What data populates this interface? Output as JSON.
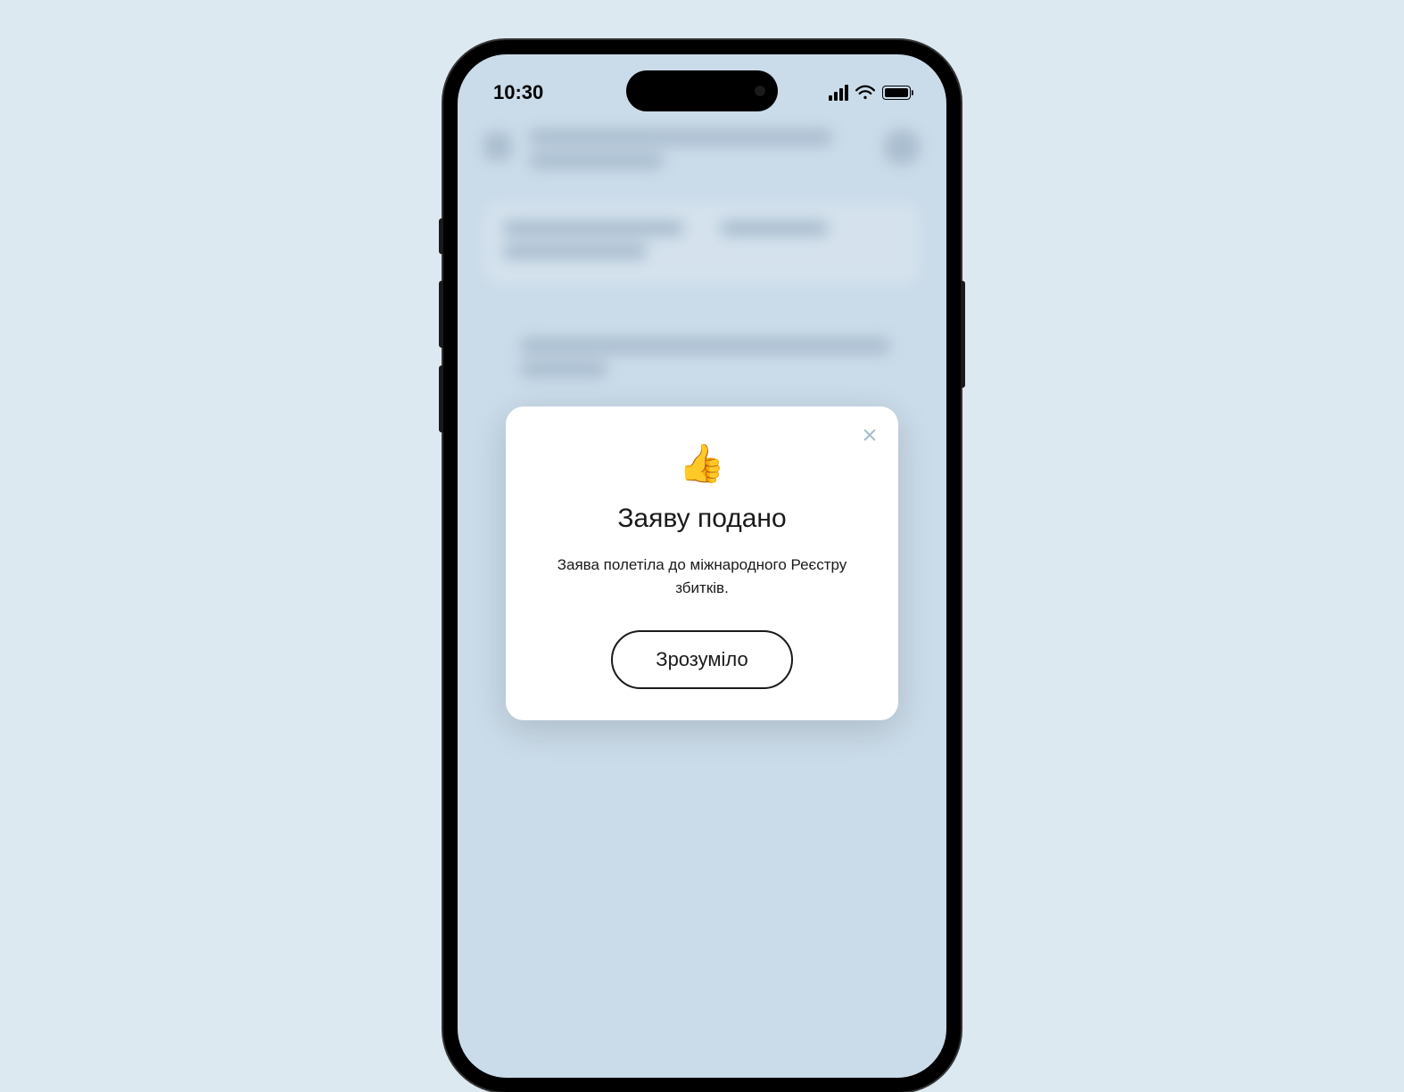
{
  "statusBar": {
    "time": "10:30"
  },
  "modal": {
    "icon": "👍",
    "title": "Заяву подано",
    "message": "Заява полетіла до міжнародного Реєстру збитків.",
    "buttonLabel": "Зрозуміло"
  }
}
